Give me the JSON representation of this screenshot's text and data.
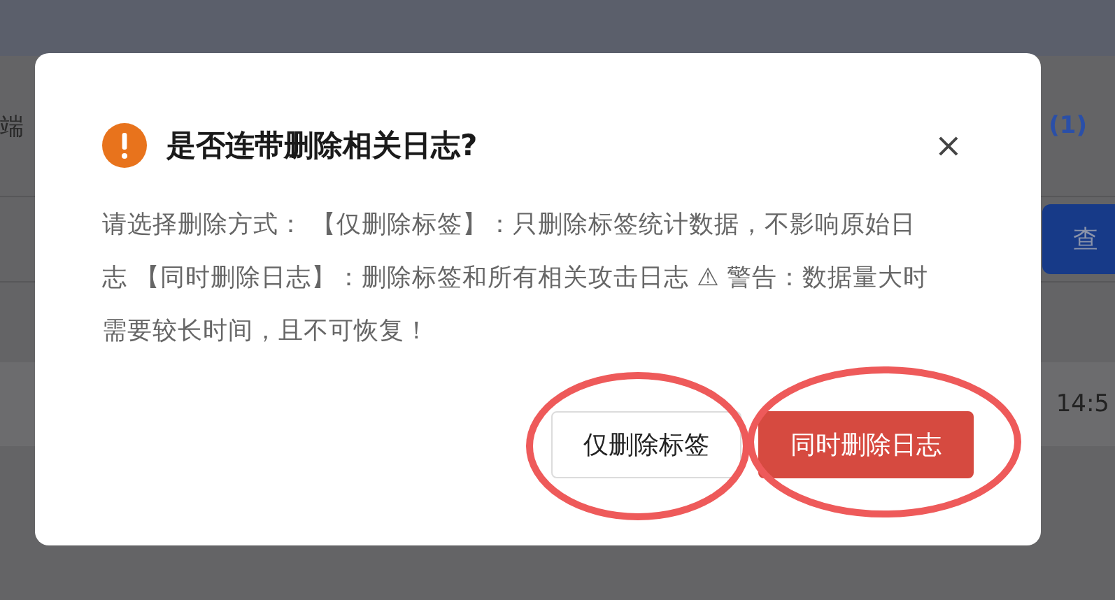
{
  "background": {
    "left_text": "端",
    "count": "(1)",
    "query_button": "查",
    "row_time": "14:5"
  },
  "dialog": {
    "title": "是否连带删除相关日志?",
    "close": "×",
    "message": "请选择删除方式：  【仅删除标签】：只删除标签统计数据，不影响原始日志 【同时删除日志】：删除标签和所有相关攻击日志 ⚠ 警告：数据量大时需要较长时间，且不可恢复！",
    "buttons": [
      {
        "label": "仅删除标签",
        "kind": "default",
        "circled": true
      },
      {
        "label": "同时删除日志",
        "kind": "primary",
        "circled": true
      }
    ]
  }
}
